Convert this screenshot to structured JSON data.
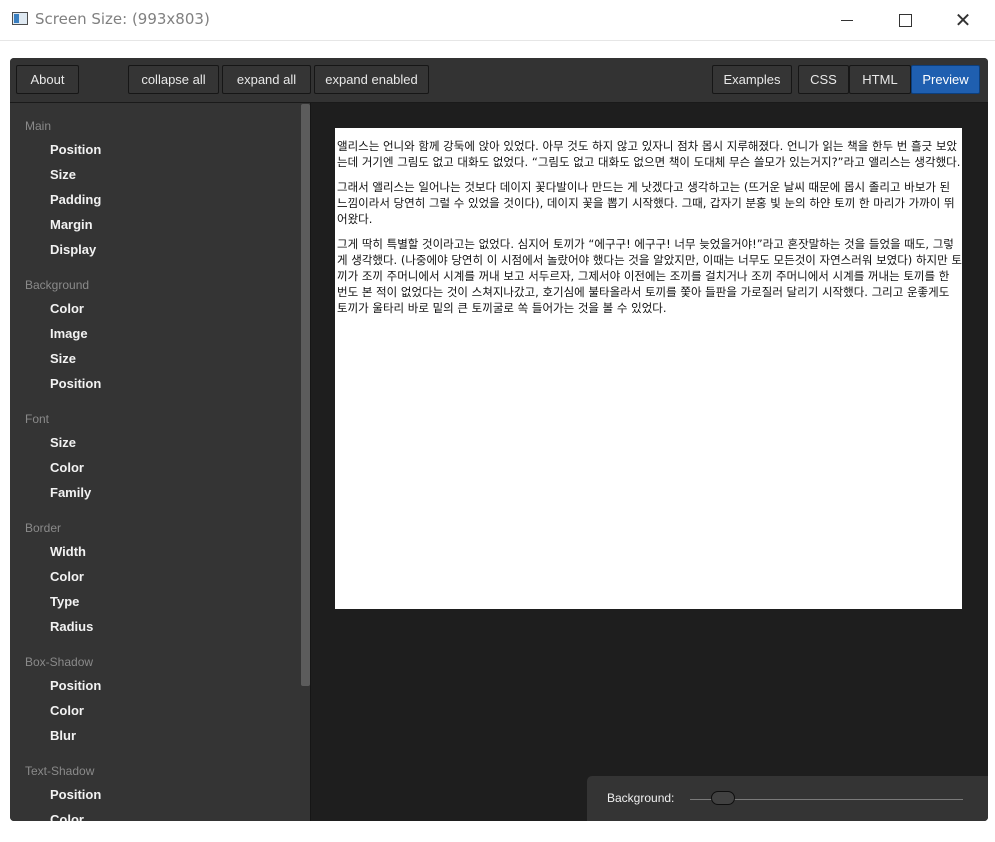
{
  "window": {
    "title": "Screen Size: (993x803)"
  },
  "toolbar": {
    "about": "About",
    "collapse_all": "collapse all",
    "expand_all": "expand all",
    "expand_enabled": "expand enabled",
    "examples": "Examples",
    "css": "CSS",
    "html": "HTML",
    "preview": "Preview"
  },
  "sidebar": {
    "sections": [
      {
        "title": "Main",
        "items": [
          "Position",
          "Size",
          "Padding",
          "Margin",
          "Display"
        ]
      },
      {
        "title": "Background",
        "items": [
          "Color",
          "Image",
          "Size",
          "Position"
        ]
      },
      {
        "title": "Font",
        "items": [
          "Size",
          "Color",
          "Family"
        ]
      },
      {
        "title": "Border",
        "items": [
          "Width",
          "Color",
          "Type",
          "Radius"
        ]
      },
      {
        "title": "Box-Shadow",
        "items": [
          "Position",
          "Color",
          "Blur"
        ]
      },
      {
        "title": "Text-Shadow",
        "items": [
          "Position",
          "Color"
        ]
      }
    ]
  },
  "preview": {
    "paragraphs": [
      "앨리스는 언니와 함께 강둑에 앉아 있었다. 아무 것도 하지 않고 있자니 점차 몹시 지루해졌다. 언니가 읽는 책을 한두 번 흘긋 보았는데 거기엔 그림도 없고 대화도 없었다. “그림도 없고 대화도 없으면 책이 도대체 무슨 쓸모가 있는거지?”라고 앨리스는 생각했다.",
      "그래서 앨리스는 일어나는 것보다 데이지 꽃다발이나 만드는 게 낫겠다고 생각하고는 (뜨거운 날씨 때문에 몹시 졸리고 바보가 된 느낌이라서 당연히 그럴 수 있었을 것이다), 데이지 꽃을 뽑기 시작했다. 그때, 갑자기 분홍 빛 눈의 하얀 토끼 한 마리가 가까이 뛰어왔다.",
      "그게 딱히 특별할 것이라고는 없었다. 심지어 토끼가 “에구구! 에구구! 너무 늦었을거야!”라고 혼잣말하는 것을 들었을 때도, 그렇게 생각했다. (나중에야 당연히 이 시점에서 놀랐어야 했다는 것을 알았지만, 이때는 너무도 모든것이 자연스러워 보였다) 하지만 토끼가 조끼 주머니에서 시계를 꺼내 보고 서두르자, 그제서야 이전에는 조끼를 걸치거나 조끼 주머니에서 시계를 꺼내는 토끼를 한 번도 본 적이 없었다는 것이 스쳐지나갔고, 호기심에 불타올라서 토끼를 쫓아 들판을 가로질러 달리기 시작했다. 그리고 운좋게도 토끼가 울타리 바로 밑의 큰 토끼굴로 쏙 들어가는 것을 볼 수 있었다."
    ]
  },
  "background_panel": {
    "label": "Background:",
    "slider_value": 0.12
  },
  "colors": {
    "accent": "#1f5fb0",
    "panel": "#343434",
    "canvas": "#1e1e1e"
  }
}
